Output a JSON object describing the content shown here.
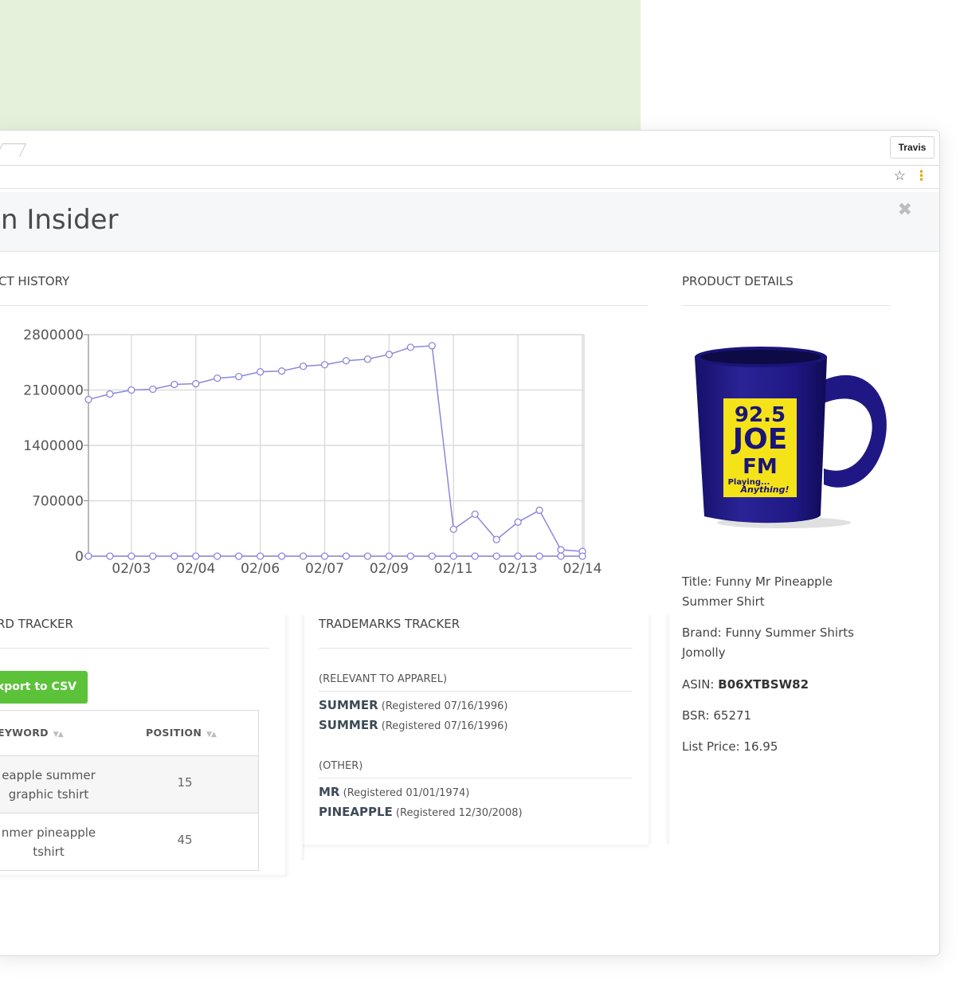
{
  "browser": {
    "profile_name": "Travis",
    "star_icon": "star-icon",
    "menu_icon": "more-vert-icon"
  },
  "modal": {
    "title": "n Insider",
    "close_icon": "close-icon"
  },
  "history": {
    "section_title": "CT HISTORY"
  },
  "chart_data": {
    "type": "line",
    "title": "",
    "xlabel": "",
    "ylabel": "",
    "ylim": [
      0,
      2800000
    ],
    "y_ticks": [
      "2800000",
      "2100000",
      "1400000",
      "700000",
      "0"
    ],
    "x_ticks": [
      "02/03",
      "02/04",
      "02/06",
      "02/07",
      "02/09",
      "02/11",
      "02/13",
      "02/14"
    ],
    "x_tick_index": [
      2,
      5,
      8,
      11,
      14,
      17,
      20,
      23
    ],
    "series": [
      {
        "color": "#8b87dd",
        "values": [
          1980000,
          2050000,
          2100000,
          2110000,
          2170000,
          2180000,
          2250000,
          2270000,
          2330000,
          2340000,
          2400000,
          2420000,
          2470000,
          2490000,
          2550000,
          2640000,
          2660000,
          340000,
          530000,
          210000,
          430000,
          580000,
          80000,
          60000
        ]
      },
      {
        "color": "#8b87dd",
        "values": [
          0,
          0,
          0,
          0,
          0,
          0,
          0,
          0,
          0,
          0,
          0,
          0,
          0,
          0,
          0,
          0,
          0,
          0,
          0,
          0,
          0,
          0,
          0,
          0
        ]
      }
    ],
    "grid": true
  },
  "keywords": {
    "section_title": "RD TRACKER",
    "export_label": "Export to CSV",
    "columns": [
      "KEYWORD",
      "POSITION"
    ],
    "rows": [
      {
        "keyword": "eapple summer graphic tshirt",
        "position": "15"
      },
      {
        "keyword": "nmer pineapple tshirt",
        "position": "45"
      }
    ]
  },
  "trademarks": {
    "section_title": "TRADEMARKS TRACKER",
    "groups": [
      {
        "category": "(RELEVANT TO APPAREL)",
        "items": [
          {
            "mark": "SUMMER",
            "detail": "(Registered 07/16/1996)"
          },
          {
            "mark": "SUMMER",
            "detail": "(Registered 07/16/1996)"
          }
        ]
      },
      {
        "category": "(OTHER)",
        "items": [
          {
            "mark": "MR",
            "detail": "(Registered 01/01/1974)"
          },
          {
            "mark": "PINEAPPLE",
            "detail": "(Registered 12/30/2008)"
          }
        ]
      }
    ]
  },
  "details": {
    "section_title": "PRODUCT DETAILS",
    "mug": {
      "line1": "92.5",
      "line2": "JOE",
      "line3": "FM",
      "line4": "Playing...",
      "line5": "Anything!"
    },
    "title_label": "Title:",
    "title_value": "Funny Mr Pineapple Summer Shirt",
    "brand_label": "Brand:",
    "brand_value": "Funny Summer Shirts Jomolly",
    "asin_label": "ASIN:",
    "asin_value": "B06XTBSW82",
    "bsr_label": "BSR:",
    "bsr_value": "65271",
    "price_label": "List Price:",
    "price_value": "16.95"
  }
}
